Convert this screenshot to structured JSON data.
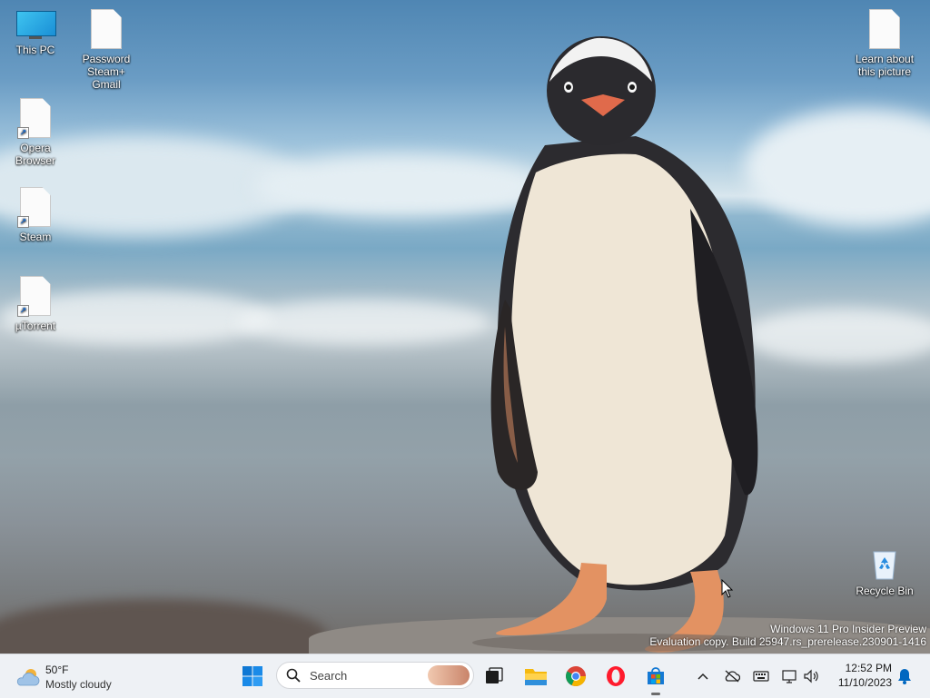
{
  "desktop": {
    "icons": [
      {
        "label": "This PC"
      },
      {
        "label": "Password Steam+ Gmail"
      },
      {
        "label": "Opera Browser"
      },
      {
        "label": "Steam"
      },
      {
        "label": "µTorrent"
      },
      {
        "label": "Learn about this picture"
      },
      {
        "label": "Recycle Bin"
      }
    ],
    "watermark_line1": "Windows 11 Pro Insider Preview",
    "watermark_line2": "Evaluation copy. Build 25947.rs_prerelease.230901-1416"
  },
  "taskbar": {
    "weather": {
      "temp": "50°F",
      "condition": "Mostly cloudy"
    },
    "search_label": "Search",
    "pinned_icons": [
      "windows-start-icon",
      "task-view-icon",
      "file-explorer-icon",
      "chrome-icon",
      "opera-icon",
      "microsoft-store-icon"
    ],
    "tray_icons": [
      "chevron-up-icon",
      "cloud-off-icon",
      "keyboard-icon",
      "network-icon",
      "volume-icon",
      "notification-bell-icon"
    ],
    "clock": {
      "time": "12:52 PM",
      "date": "11/10/2023"
    }
  },
  "colors": {
    "taskbar_bg": "#eef1f5",
    "accent_blue": "#0f6cbd",
    "notification_blue": "#0067c0"
  }
}
